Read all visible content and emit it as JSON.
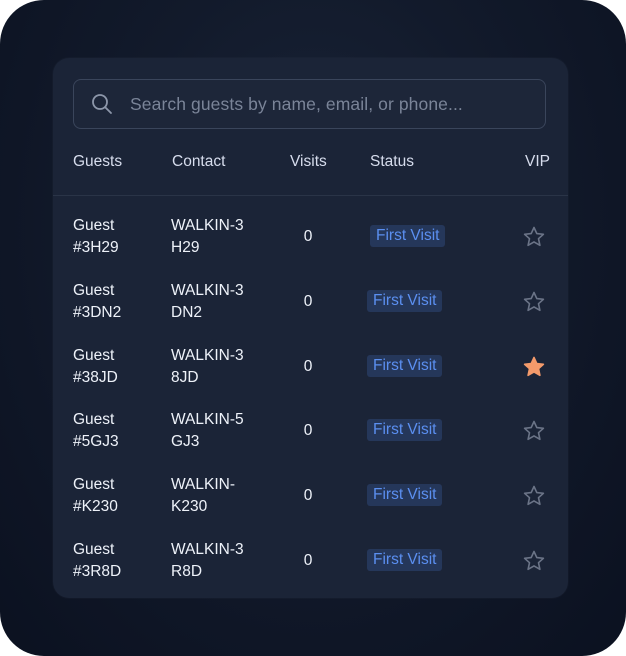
{
  "search": {
    "placeholder": "Search guests by name, email, or phone...",
    "icon": "search-icon"
  },
  "columns": {
    "guests": "Guests",
    "contact": "Contact",
    "visits": "Visits",
    "status": "Status",
    "vip": "VIP"
  },
  "colors": {
    "badge_text": "#5b8ff0",
    "badge_bg": "#25375a",
    "vip_active": "#f39a6b",
    "vip_inactive": "#6b7487"
  },
  "rows": [
    {
      "guest_line1": "Guest",
      "guest_line2": "#3H29",
      "contact_line1": "WALKIN-3",
      "contact_line2": "H29",
      "visits": "0",
      "status": "First Visit",
      "vip": false
    },
    {
      "guest_line1": "Guest",
      "guest_line2": "#3DN2",
      "contact_line1": "WALKIN-3",
      "contact_line2": "DN2",
      "visits": "0",
      "status": "First Visit",
      "vip": false
    },
    {
      "guest_line1": "Guest",
      "guest_line2": "#38JD",
      "contact_line1": "WALKIN-3",
      "contact_line2": "8JD",
      "visits": "0",
      "status": "First Visit",
      "vip": true
    },
    {
      "guest_line1": "Guest",
      "guest_line2": "#5GJ3",
      "contact_line1": "WALKIN-5",
      "contact_line2": "GJ3",
      "visits": "0",
      "status": "First Visit",
      "vip": false
    },
    {
      "guest_line1": "Guest",
      "guest_line2": "#K230",
      "contact_line1": "WALKIN-",
      "contact_line2": "K230",
      "visits": "0",
      "status": "First Visit",
      "vip": false
    },
    {
      "guest_line1": "Guest",
      "guest_line2": "#3R8D",
      "contact_line1": "WALKIN-3",
      "contact_line2": "R8D",
      "visits": "0",
      "status": "First Visit",
      "vip": false
    }
  ]
}
